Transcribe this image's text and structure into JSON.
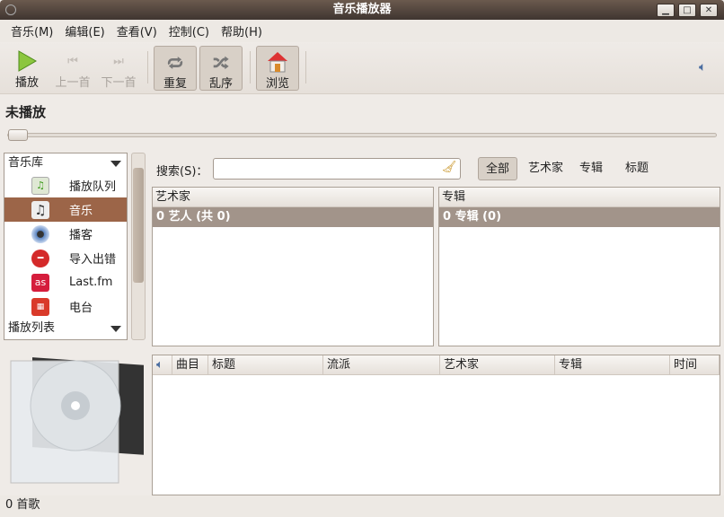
{
  "window": {
    "title": "音乐播放器"
  },
  "menu": [
    "音乐(M)",
    "编辑(E)",
    "查看(V)",
    "控制(C)",
    "帮助(H)"
  ],
  "toolbar": {
    "play": "播放",
    "prev": "上一首",
    "next": "下一首",
    "repeat": "重复",
    "shuffle": "乱序",
    "browse": "浏览"
  },
  "now_playing": "未播放",
  "sidebar": {
    "library_header": "音乐库",
    "items": [
      "播放队列",
      "音乐",
      "播客",
      "导入出错",
      "Last.fm",
      "电台"
    ],
    "playlist_header": "播放列表"
  },
  "search": {
    "label": "搜索(S)：",
    "value": ""
  },
  "filters": [
    "全部",
    "艺术家",
    "专辑",
    "标题"
  ],
  "artist_pane": {
    "header": "艺术家",
    "row": "0 艺人 (共 0)"
  },
  "album_pane": {
    "header": "专辑",
    "row": "0 专辑 (0)"
  },
  "tracks": {
    "columns": [
      "曲目",
      "标题",
      "流派",
      "艺术家",
      "专辑",
      "时间"
    ]
  },
  "status": "0 首歌",
  "colors": {
    "selection": "#9c6548",
    "titlebar": "#4f433b"
  }
}
